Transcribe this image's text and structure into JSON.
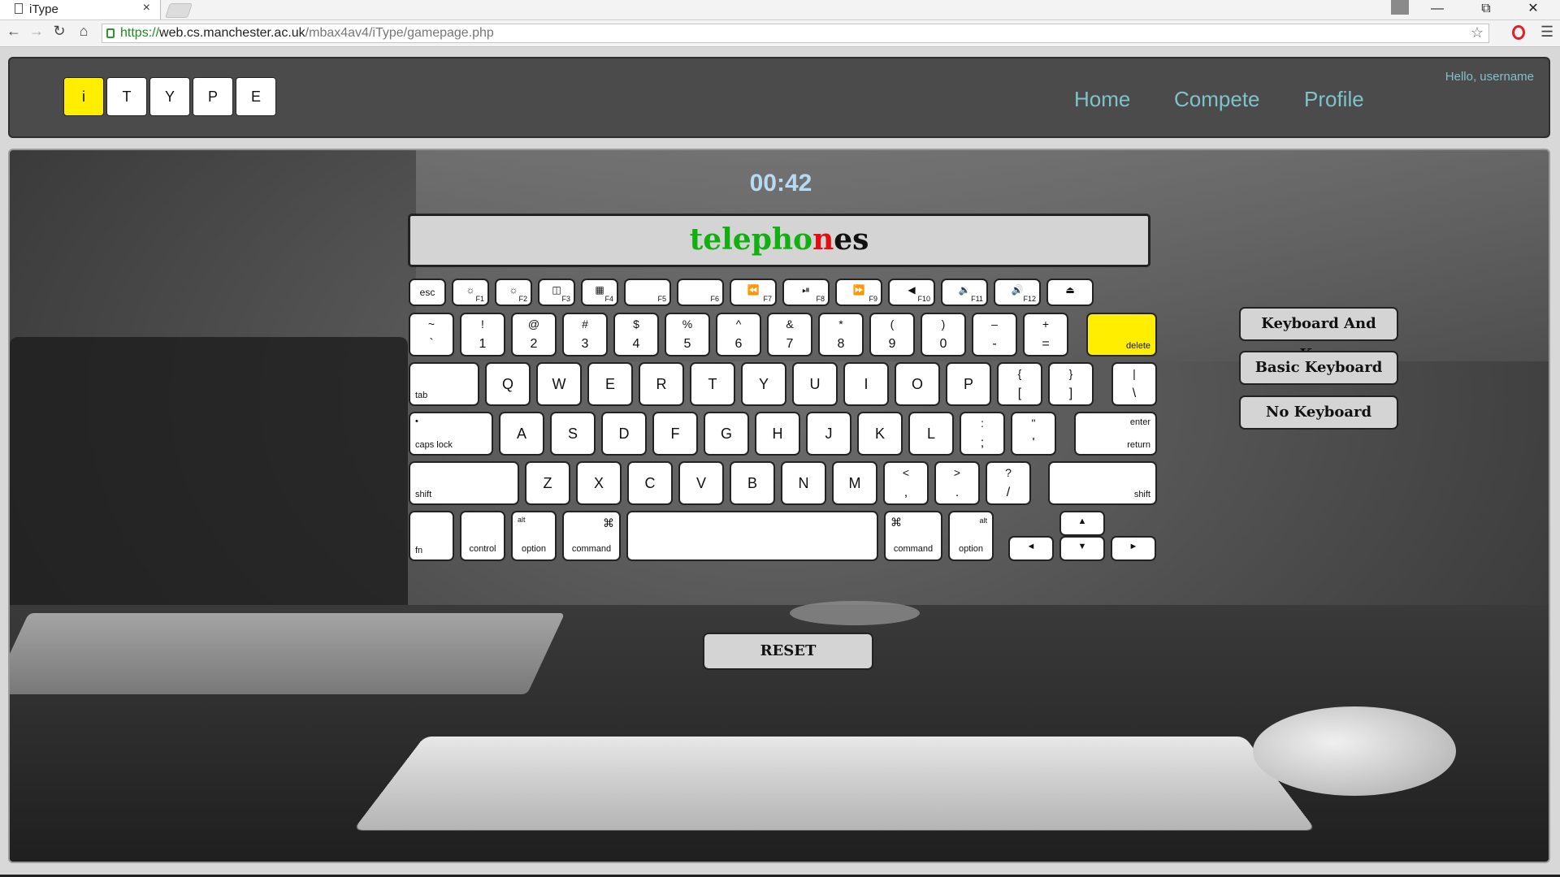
{
  "browser": {
    "tab_title": "iType",
    "tab_close": "×",
    "url_scheme": "https://",
    "url_host": "web.cs.manchester.ac.uk",
    "url_path": "/mbax4av4/iType/gamepage.php",
    "icons": [
      "doc-icon",
      "back-icon",
      "forward-icon",
      "reload-icon",
      "home-icon",
      "lock-icon",
      "star-icon",
      "opera-icon",
      "menu-icon",
      "user-icon"
    ]
  },
  "header": {
    "logo_letters": [
      "i",
      "T",
      "Y",
      "P",
      "E"
    ],
    "nav": {
      "home": "Home",
      "compete": "Compete",
      "profile": "Profile"
    },
    "greeting": "Hello, username",
    "accent_color": "#7fc2c9",
    "logo_highlight_color": "#ffee00"
  },
  "game": {
    "timer": "00:42",
    "word_typed": "telepho",
    "word_error": "n",
    "word_rest": "es",
    "typed_color": "#10b010",
    "error_color": "#e01010",
    "reset_label": "RESET"
  },
  "options": {
    "keyboard_and_keys": "Keyboard And Keys",
    "basic_keyboard": "Basic Keyboard",
    "no_keyboard": "No Keyboard"
  },
  "keyboard": {
    "highlighted_key": "delete",
    "function_row": {
      "esc": "esc",
      "f1": "F1",
      "f2": "F2",
      "f3": "F3",
      "f4": "F4",
      "f5": "F5",
      "f6": "F6",
      "f7": "F7",
      "f8": "F8",
      "f9": "F9",
      "f10": "F10",
      "f11": "F11",
      "f12": "F12"
    },
    "number_row": [
      {
        "top": "~",
        "bottom": "`"
      },
      {
        "top": "!",
        "bottom": "1"
      },
      {
        "top": "@",
        "bottom": "2"
      },
      {
        "top": "#",
        "bottom": "3"
      },
      {
        "top": "$",
        "bottom": "4"
      },
      {
        "top": "%",
        "bottom": "5"
      },
      {
        "top": "^",
        "bottom": "6"
      },
      {
        "top": "&",
        "bottom": "7"
      },
      {
        "top": "*",
        "bottom": "8"
      },
      {
        "top": "(",
        "bottom": "9"
      },
      {
        "top": ")",
        "bottom": "0"
      },
      {
        "top": "–",
        "bottom": "-"
      },
      {
        "top": "+",
        "bottom": "="
      }
    ],
    "delete": "delete",
    "tab": "tab",
    "qwerty": [
      "Q",
      "W",
      "E",
      "R",
      "T",
      "Y",
      "U",
      "I",
      "O",
      "P"
    ],
    "bracket_keys": [
      {
        "top": "{",
        "bottom": "["
      },
      {
        "top": "}",
        "bottom": "]"
      },
      {
        "top": "|",
        "bottom": "\\"
      }
    ],
    "caps_lock": "caps lock",
    "caps_dot": "•",
    "home_row": [
      "A",
      "S",
      "D",
      "F",
      "G",
      "H",
      "J",
      "K",
      "L"
    ],
    "home_punct": [
      {
        "top": ":",
        "bottom": ";"
      },
      {
        "top": "\"",
        "bottom": "'"
      }
    ],
    "enter": "enter",
    "return": "return",
    "shift": "shift",
    "bottom_row": [
      "Z",
      "X",
      "C",
      "V",
      "B",
      "N",
      "M"
    ],
    "bottom_punct": [
      {
        "top": "<",
        "bottom": ","
      },
      {
        "top": ">",
        "bottom": "."
      },
      {
        "top": "?",
        "bottom": "/"
      }
    ],
    "fn": "fn",
    "control": "control",
    "alt": "alt",
    "option": "option",
    "cmd_symbol": "⌘",
    "command": "command",
    "arrow_up": "▲",
    "arrow_down": "▼",
    "arrow_left": "◄",
    "arrow_right": "►"
  }
}
